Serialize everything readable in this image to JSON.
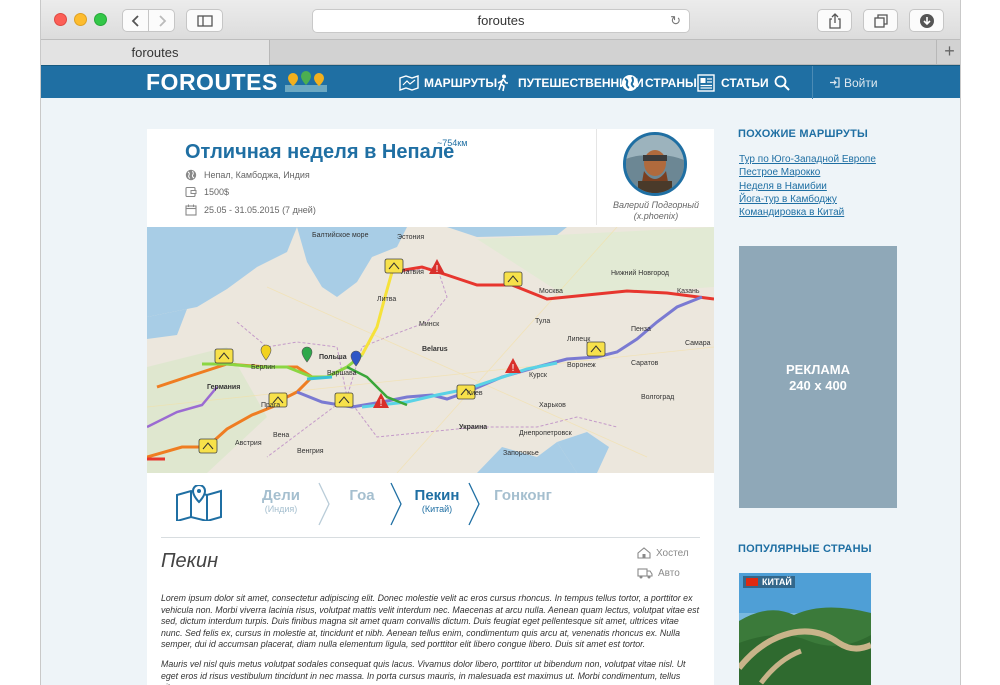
{
  "browser": {
    "url": "foroutes",
    "tab_title": "foroutes",
    "new_tab": "+"
  },
  "site": {
    "logo": "FOROUTES",
    "nav": [
      {
        "label": "МАРШРУТЫ",
        "icon": "map-icon"
      },
      {
        "label": "ПУТЕШЕСТВЕННИКИ",
        "icon": "walker-icon"
      },
      {
        "label": "СТРАНЫ",
        "icon": "globe-icon"
      },
      {
        "label": "СТАТЬИ",
        "icon": "article-icon"
      }
    ],
    "login": "Войти"
  },
  "route": {
    "title": "Отличная неделя в Непале",
    "distance": "~754км",
    "countries": "Непал, Камбоджа, Индия",
    "budget": "1500$",
    "dates": "25.05 - 31.05.2015 (7 дней)",
    "author_name": "Валерий Подгорный",
    "author_nick": "(x.phoenix)"
  },
  "map_labels": {
    "estonia": "Эстония",
    "latvia": "Латвия",
    "lithuania": "Литва",
    "baltic": "Балтийское море",
    "minsk": "Минск",
    "belarus": "Belarus",
    "poland": "Польша",
    "germany": "Германия",
    "ukraine": "Украина",
    "moscow": "Москва",
    "nizhny": "Нижний Новгород",
    "kazan": "Казань",
    "samara": "Самара",
    "kharkiv": "Харьков",
    "kiev": "Киев",
    "warsaw": "Варшава",
    "berlin": "Берлин",
    "prague": "Прага",
    "vienna": "Вена",
    "hungary": "Венгрия",
    "austria": "Австрия",
    "dnepr": "Днепропетровск",
    "zaporozhye": "Запорожье",
    "volgograd": "Волгоград",
    "tula": "Тула",
    "kursk": "Курск",
    "voronezh": "Воронеж",
    "lipetsk": "Липецк",
    "penza": "Пенза",
    "saratov": "Саратов"
  },
  "stops": [
    {
      "name": "Дели",
      "sub": "(Индия)",
      "active": false
    },
    {
      "name": "Гоа",
      "sub": "",
      "active": false
    },
    {
      "name": "Пекин",
      "sub": "(Китай)",
      "active": true
    },
    {
      "name": "Гонконг",
      "sub": "",
      "active": false
    }
  ],
  "city": {
    "name": "Пекин",
    "tag_hostel": "Хостел",
    "tag_auto": "Авто"
  },
  "paragraphs": [
    "Lorem ipsum dolor sit amet, consectetur adipiscing elit. Donec molestie velit ac eros cursus rhoncus. In tempus tellus tortor, a porttitor ex vehicula non. Morbi viverra lacinia risus, volutpat mattis velit interdum nec. Maecenas at arcu nulla. Aenean quam lectus, volutpat vitae est sed, dictum interdum turpis. Duis finibus magna sit amet quam convallis dictum. Duis feugiat eget pellentesque sit amet, ultrices vitae nunc. Sed felis ex, cursus in molestie at, tincidunt et nibh. Aenean tellus enim, condimentum quis arcu at, venenatis rhoncus ex. Nulla semper, dui id accumsan placerat, diam nulla elementum ligula, sed porttitor elit libero congue libero. Duis sit amet est tortor.",
    "Mauris vel nisl quis metus volutpat sodales consequat quis lacus. Vivamus dolor libero, porttitor ut bibendum non, volutpat vitae nisl. Ut eget eros id risus vestibulum tincidunt in nec massa. In porta cursus mauris, in malesuada est maximus ut. Morbi condimentum, tellus vitae"
  ],
  "sidebar": {
    "similar_heading": "ПОХОЖИЕ МАРШРУТЫ",
    "similar": [
      "Тур по Юго-Западной Европе",
      "Пестрое Марокко",
      "Неделя в Намибии",
      "Йога-тур в Камбоджу",
      "Командировка в Китай"
    ],
    "ad_line1": "РЕКЛАМА",
    "ad_line2": "240 x 400",
    "popular_heading": "ПОПУЛЯРНЫЕ СТРАНЫ",
    "country": "КИТАЙ"
  }
}
